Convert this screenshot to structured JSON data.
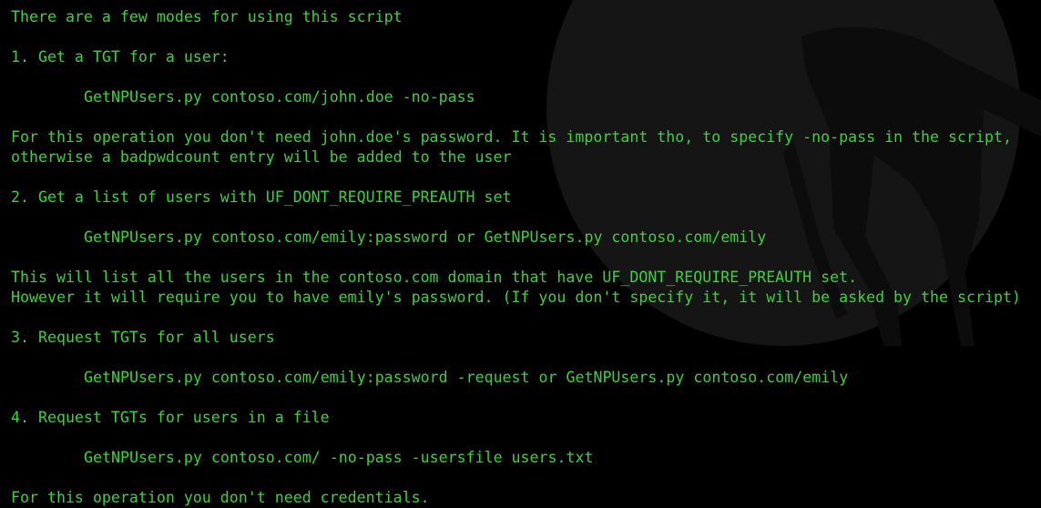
{
  "terminal": {
    "text_color": "#3ad33a",
    "background_color": "#000000",
    "wallpaper_color": "#151515",
    "lines": [
      {
        "text": "There are a few modes for using this script",
        "indent": false
      },
      {
        "text": "",
        "indent": false
      },
      {
        "text": "1. Get a TGT for a user:",
        "indent": false
      },
      {
        "text": "",
        "indent": false
      },
      {
        "text": "GetNPUsers.py contoso.com/john.doe -no-pass",
        "indent": true
      },
      {
        "text": "",
        "indent": false
      },
      {
        "text": "For this operation you don't need john.doe's password. It is important tho, to specify -no-pass in the script,",
        "indent": false
      },
      {
        "text": "otherwise a badpwdcount entry will be added to the user",
        "indent": false
      },
      {
        "text": "",
        "indent": false
      },
      {
        "text": "2. Get a list of users with UF_DONT_REQUIRE_PREAUTH set",
        "indent": false
      },
      {
        "text": "",
        "indent": false
      },
      {
        "text": "GetNPUsers.py contoso.com/emily:password or GetNPUsers.py contoso.com/emily",
        "indent": true
      },
      {
        "text": "",
        "indent": false
      },
      {
        "text": "This will list all the users in the contoso.com domain that have UF_DONT_REQUIRE_PREAUTH set.",
        "indent": false
      },
      {
        "text": "However it will require you to have emily's password. (If you don't specify it, it will be asked by the script)",
        "indent": false
      },
      {
        "text": "",
        "indent": false
      },
      {
        "text": "3. Request TGTs for all users",
        "indent": false
      },
      {
        "text": "",
        "indent": false
      },
      {
        "text": "GetNPUsers.py contoso.com/emily:password -request or GetNPUsers.py contoso.com/emily",
        "indent": true
      },
      {
        "text": "",
        "indent": false
      },
      {
        "text": "4. Request TGTs for users in a file",
        "indent": false
      },
      {
        "text": "",
        "indent": false
      },
      {
        "text": "GetNPUsers.py contoso.com/ -no-pass -usersfile users.txt",
        "indent": true
      },
      {
        "text": "",
        "indent": false
      },
      {
        "text": "For this operation you don't need credentials.",
        "indent": false
      }
    ]
  }
}
